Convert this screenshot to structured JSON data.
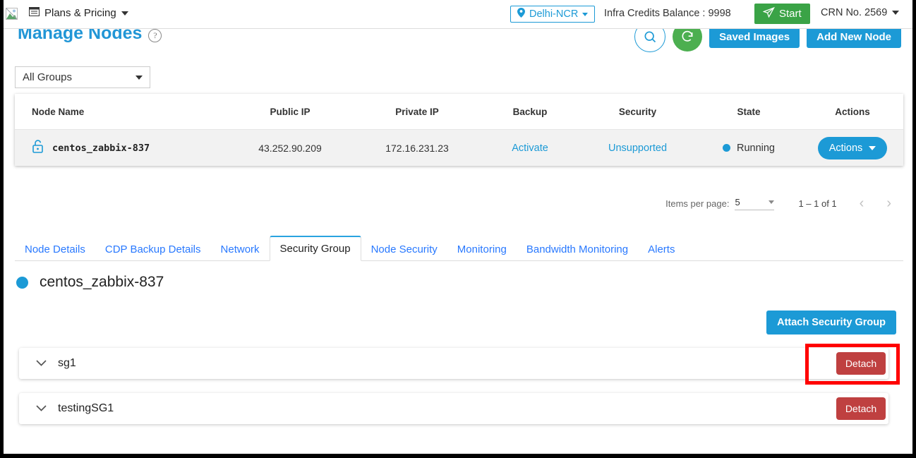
{
  "header": {
    "logo_icon": "broken-image-icon",
    "plans_label": "Plans & Pricing",
    "plans_icon": "window-list-icon",
    "region_label": "Delhi-NCR",
    "region_icon": "location-pin-icon",
    "balance_label": "Infra Credits Balance : 9998",
    "start_label": "Start",
    "start_icon": "send-plane-icon",
    "crn_label": "CRN No. 2569",
    "accent_blue": "#1c9ad6",
    "start_green": "#3aa346"
  },
  "page": {
    "title": "Manage Nodes",
    "help_icon": "question-mark-icon",
    "search_icon": "search-icon",
    "refresh_icon": "refresh-icon",
    "saved_images_label": "Saved Images",
    "add_node_label": "Add New Node"
  },
  "filters": {
    "group_select_value": "All Groups"
  },
  "node_table": {
    "columns": [
      "Node Name",
      "Public IP",
      "Private IP",
      "Backup",
      "Security",
      "State",
      "Actions"
    ],
    "rows": [
      {
        "lock_icon": "unlock-icon",
        "name": "centos_zabbix-837",
        "public_ip": "43.252.90.209",
        "private_ip": "172.16.231.23",
        "backup": "Activate",
        "security": "Unsupported",
        "state": "Running",
        "actions_label": "Actions"
      }
    ]
  },
  "paginator": {
    "items_per_page_label": "Items per page:",
    "items_per_page_value": "5",
    "range_label": "1 – 1 of 1",
    "prev_icon": "chevron-left-icon",
    "next_icon": "chevron-right-icon"
  },
  "tabs": [
    {
      "label": "Node Details",
      "active": false
    },
    {
      "label": "CDP Backup Details",
      "active": false
    },
    {
      "label": "Network",
      "active": false
    },
    {
      "label": "Security Group",
      "active": true
    },
    {
      "label": "Node Security",
      "active": false
    },
    {
      "label": "Monitoring",
      "active": false
    },
    {
      "label": "Bandwidth Monitoring",
      "active": false
    },
    {
      "label": "Alerts",
      "active": false
    }
  ],
  "security_group_panel": {
    "node_name": "centos_zabbix-837",
    "attach_label": "Attach Security Group",
    "groups": [
      {
        "name": "sg1",
        "detach_label": "Detach",
        "expand_icon": "chevron-down-icon"
      },
      {
        "name": "testingSG1",
        "detach_label": "Detach",
        "expand_icon": "chevron-down-icon"
      }
    ],
    "detach_red": "#bf4040"
  },
  "annotation": {
    "color": "#ff0000",
    "target": "detach-button-sg1"
  }
}
